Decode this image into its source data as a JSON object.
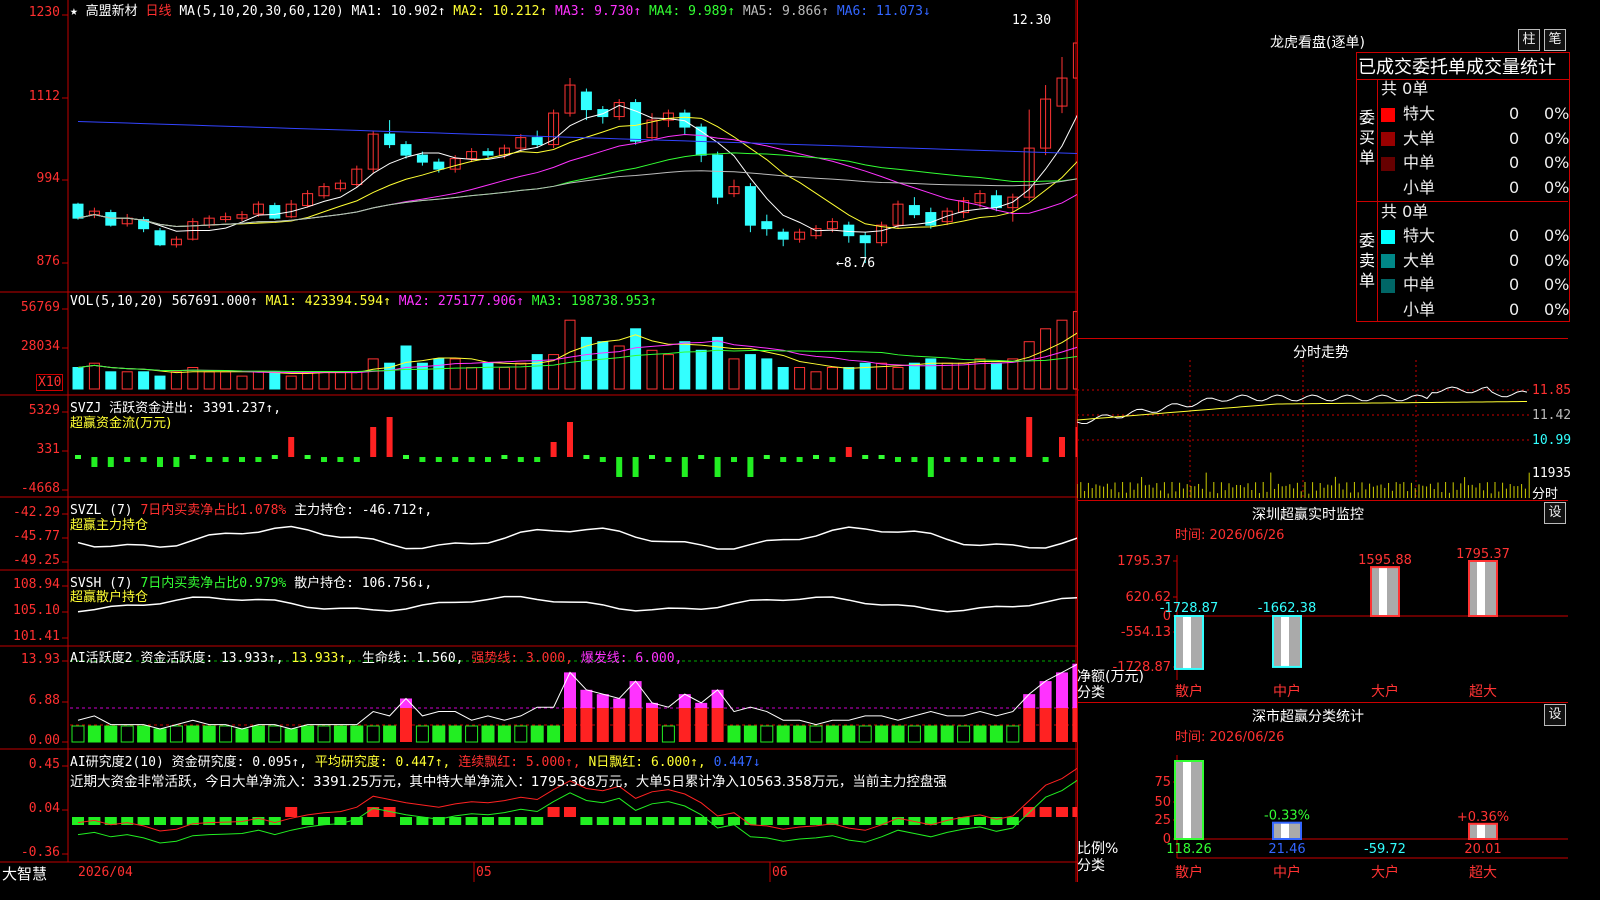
{
  "header": {
    "star": "★",
    "stock_name": "高盟新材",
    "period": "日线",
    "ma_params": "MA(5,10,20,30,60,120)",
    "ma1": "MA1: 10.902↑",
    "ma2": "MA2: 10.212↑",
    "ma3": "MA3: 9.730↑",
    "ma4": "MA4: 9.989↑",
    "ma5": "MA5: 9.866↑",
    "ma6": "MA6: 11.073↓"
  },
  "price_axis": [
    "1230",
    "1112",
    "994",
    "876"
  ],
  "price_marks": {
    "high": "12.30",
    "low": "←8.76"
  },
  "vol": {
    "label": "VOL(5,10,20)",
    "value": "567691.000↑",
    "ma1": "MA1: 423394.594↑",
    "ma2": "MA2: 275177.906↑",
    "ma3": "MA3: 198738.953↑",
    "axis": [
      "56769",
      "28034",
      "X10"
    ]
  },
  "svzj": {
    "label": "SVZJ",
    "text": "活跃资金进出: 3391.237↑,",
    "subtitle": "超赢资金流(万元)",
    "axis": [
      "5329",
      "331",
      "-4668"
    ]
  },
  "svzl": {
    "label": "SVZL (7)",
    "ratio": "7日内买卖净占比1.078%",
    "text": "主力持仓: -46.712↑,",
    "subtitle": "超赢主力持仓",
    "axis": [
      "-42.29",
      "-45.77",
      "-49.25"
    ]
  },
  "svsh": {
    "label": "SVSH (7)",
    "ratio": "7日内买卖净占比0.979%",
    "text": "散户持仓: 106.756↓,",
    "subtitle": "超赢散户持仓",
    "axis": [
      "108.94",
      "105.10",
      "101.41"
    ]
  },
  "ai_active": {
    "label": "AI活跃度2",
    "v1": "资金活跃度: 13.933↑,",
    "v2": "13.933↑,",
    "v3": "生命线: 1.560,",
    "v4": "强势线: 3.000,",
    "v5": "爆发线: 6.000,",
    "axis": [
      "13.93",
      "6.88",
      "0.00"
    ]
  },
  "ai_research": {
    "label": "AI研究度2(10)",
    "v1": "资金研究度: 0.095↑,",
    "v2": "平均研究度: 0.447↑,",
    "v3": "连续飘红: 5.000↑,",
    "v4": "N日飘红: 6.000↑,",
    "v5": "0.447↓",
    "note": "近期大资金非常活跃，今日大单净流入：3391.25万元，其中特大单净流入：1795.368万元，大单5日累计净入10563.358万元，当前主力控盘强",
    "axis": [
      "0.45",
      "0.04",
      "-0.36"
    ]
  },
  "bottom": {
    "brand": "大智慧",
    "dates": [
      "2026/04",
      "05",
      "06"
    ]
  },
  "right": {
    "title": "龙虎看盘(逐单)",
    "btn_bar": "柱",
    "btn_pen": "笔",
    "subtitle": "已成交委托单成交量统计",
    "buy_label": "委买单",
    "sell_label": "委卖单",
    "buy_total": "共 0单",
    "sell_total": "共 0单",
    "buy_rows": [
      {
        "name": "特大",
        "count": "0",
        "pct": "0%",
        "color": "#ff0000"
      },
      {
        "name": "大单",
        "count": "0",
        "pct": "0%",
        "color": "#990000"
      },
      {
        "name": "中单",
        "count": "0",
        "pct": "0%",
        "color": "#660000"
      },
      {
        "name": "小单",
        "count": "0",
        "pct": "0%",
        "color": "#000000"
      }
    ],
    "sell_rows": [
      {
        "name": "特大",
        "count": "0",
        "pct": "0%",
        "color": "#00ffff"
      },
      {
        "name": "大单",
        "count": "0",
        "pct": "0%",
        "color": "#008888"
      },
      {
        "name": "中单",
        "count": "0",
        "pct": "0%",
        "color": "#006666"
      },
      {
        "name": "小单",
        "count": "0",
        "pct": "0%",
        "color": "#000000"
      }
    ],
    "intraday_title": "分时走势",
    "intraday_axis": [
      "11.85",
      "11.42",
      "10.99",
      "11935",
      "分时"
    ],
    "sz_monitor": {
      "title": "深圳超赢实时监控",
      "btn": "设",
      "time": "时间: 2026/06/26",
      "axis": [
        "1795.37",
        "620.62",
        "0",
        "-554.13",
        "-1728.87"
      ],
      "ylabel": "净额(万元)",
      "xlabel": "分类",
      "categories": [
        "散户",
        "中户",
        "大户",
        "超大"
      ],
      "values": [
        "-1728.87",
        "-1662.38",
        "1595.88",
        "1795.37"
      ]
    },
    "sz_class": {
      "title": "深市超赢分类统计",
      "btn": "设",
      "time": "时间: 2026/06/26",
      "axis": [
        "75",
        "50",
        "25",
        "0"
      ],
      "ylabel": "比例%",
      "xlabel": "分类",
      "categories": [
        "散户",
        "中户",
        "大户",
        "超大"
      ],
      "pct_labels": [
        "",
        "-0.33%",
        "",
        "+0.36%"
      ],
      "values": [
        "118.26",
        "21.46",
        "-59.72",
        "20.01"
      ]
    }
  },
  "chart_data": {
    "type": "candlestick",
    "title": "高盟新材 日线",
    "ylim": [
      8.76,
      12.3
    ],
    "ohlc": [
      [
        9.6,
        9.4,
        9.62,
        9.38
      ],
      [
        9.45,
        9.5,
        9.55,
        9.4
      ],
      [
        9.48,
        9.3,
        9.52,
        9.28
      ],
      [
        9.32,
        9.4,
        9.46,
        9.28
      ],
      [
        9.38,
        9.25,
        9.42,
        9.2
      ],
      [
        9.22,
        9.02,
        9.26,
        9.0
      ],
      [
        9.02,
        9.1,
        9.14,
        8.98
      ],
      [
        9.1,
        9.35,
        9.4,
        9.08
      ],
      [
        9.3,
        9.4,
        9.44,
        9.26
      ],
      [
        9.38,
        9.42,
        9.48,
        9.34
      ],
      [
        9.4,
        9.45,
        9.5,
        9.36
      ],
      [
        9.46,
        9.6,
        9.64,
        9.42
      ],
      [
        9.58,
        9.4,
        9.62,
        9.38
      ],
      [
        9.42,
        9.6,
        9.66,
        9.4
      ],
      [
        9.58,
        9.75,
        9.8,
        9.55
      ],
      [
        9.72,
        9.85,
        9.9,
        9.68
      ],
      [
        9.82,
        9.9,
        9.95,
        9.78
      ],
      [
        9.88,
        10.1,
        10.15,
        9.85
      ],
      [
        10.1,
        10.6,
        10.65,
        10.05
      ],
      [
        10.6,
        10.45,
        10.8,
        10.4
      ],
      [
        10.45,
        10.3,
        10.5,
        10.25
      ],
      [
        10.3,
        10.2,
        10.35,
        10.15
      ],
      [
        10.2,
        10.1,
        10.25,
        10.05
      ],
      [
        10.1,
        10.25,
        10.3,
        10.05
      ],
      [
        10.25,
        10.35,
        10.4,
        10.2
      ],
      [
        10.35,
        10.3,
        10.4,
        10.25
      ],
      [
        10.3,
        10.4,
        10.45,
        10.25
      ],
      [
        10.4,
        10.55,
        10.6,
        10.35
      ],
      [
        10.55,
        10.45,
        10.65,
        10.4
      ],
      [
        10.45,
        10.9,
        10.95,
        10.4
      ],
      [
        10.9,
        11.3,
        11.4,
        10.85
      ],
      [
        11.2,
        10.95,
        11.25,
        10.8
      ],
      [
        10.95,
        10.85,
        11.0,
        10.75
      ],
      [
        10.85,
        11.05,
        11.1,
        10.8
      ],
      [
        11.05,
        10.5,
        11.1,
        10.45
      ],
      [
        10.55,
        10.8,
        10.9,
        10.5
      ],
      [
        10.8,
        10.9,
        10.95,
        10.7
      ],
      [
        10.9,
        10.7,
        10.95,
        10.6
      ],
      [
        10.7,
        10.3,
        10.75,
        10.2
      ],
      [
        10.3,
        9.7,
        10.35,
        9.6
      ],
      [
        9.75,
        9.85,
        9.95,
        9.7
      ],
      [
        9.85,
        9.3,
        9.9,
        9.2
      ],
      [
        9.35,
        9.25,
        9.45,
        9.15
      ],
      [
        9.2,
        9.1,
        9.25,
        9.0
      ],
      [
        9.1,
        9.2,
        9.25,
        9.05
      ],
      [
        9.15,
        9.25,
        9.3,
        9.1
      ],
      [
        9.25,
        9.35,
        9.4,
        9.2
      ],
      [
        9.3,
        9.15,
        9.35,
        9.05
      ],
      [
        9.15,
        9.05,
        9.2,
        8.76
      ],
      [
        9.05,
        9.3,
        9.35,
        9.0
      ],
      [
        9.3,
        9.6,
        9.65,
        9.25
      ],
      [
        9.58,
        9.45,
        9.7,
        9.4
      ],
      [
        9.48,
        9.3,
        9.55,
        9.25
      ],
      [
        9.35,
        9.5,
        9.55,
        9.3
      ],
      [
        9.48,
        9.65,
        9.7,
        9.4
      ],
      [
        9.62,
        9.75,
        9.8,
        9.55
      ],
      [
        9.72,
        9.55,
        9.8,
        9.5
      ],
      [
        9.55,
        9.7,
        9.75,
        9.35
      ],
      [
        9.7,
        10.4,
        10.95,
        9.65
      ],
      [
        10.4,
        11.1,
        11.3,
        10.3
      ],
      [
        11.0,
        11.4,
        11.7,
        10.9
      ],
      [
        11.4,
        11.9,
        12.3,
        11.3
      ]
    ],
    "volume": [
      5,
      6,
      4,
      4,
      4,
      3,
      4,
      5,
      4,
      4,
      3,
      4,
      4,
      3,
      4,
      4,
      4,
      4,
      7,
      6,
      10,
      6,
      7,
      7,
      5,
      6,
      5,
      6,
      8,
      8,
      16,
      12,
      11,
      10,
      14,
      9,
      8,
      11,
      9,
      12,
      7,
      8,
      7,
      5,
      5,
      4,
      5,
      5,
      6,
      6,
      5,
      6,
      7,
      6,
      6,
      7,
      6,
      7,
      11,
      14,
      16,
      18
    ],
    "fund_flow": [
      0,
      -2,
      -2,
      -1,
      -1,
      -2,
      -2,
      0,
      -1,
      -1,
      -1,
      -1,
      0,
      4,
      0,
      -1,
      -1,
      -1,
      6,
      8,
      0,
      -1,
      -1,
      -1,
      -1,
      -1,
      0,
      -1,
      -1,
      3,
      7,
      0,
      -1,
      -4,
      -4,
      0,
      -1,
      -4,
      0,
      -4,
      -1,
      -4,
      0,
      -1,
      -1,
      0,
      -1,
      2,
      0,
      0,
      -1,
      -1,
      -4,
      -1,
      -1,
      -1,
      -1,
      -1,
      8,
      -1,
      4,
      6
    ]
  }
}
